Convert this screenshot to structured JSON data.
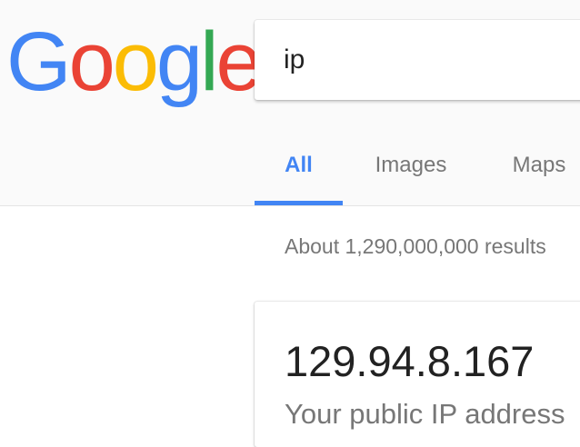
{
  "logo": {
    "letters": [
      "G",
      "o",
      "o",
      "g",
      "l",
      "e"
    ],
    "colors": [
      "#4285f4",
      "#ea4335",
      "#fbbc05",
      "#4285f4",
      "#34a853",
      "#ea4335"
    ]
  },
  "search": {
    "value": "ip"
  },
  "tabs": [
    {
      "label": "All",
      "active": true
    },
    {
      "label": "Images",
      "active": false
    },
    {
      "label": "Maps",
      "active": false
    }
  ],
  "colors": {
    "accent": "#4285f4",
    "header_bg": "#fafafa",
    "muted_text": "#777777"
  },
  "results": {
    "stats": "About 1,290,000,000 results"
  },
  "ip_card": {
    "ip": "129.94.8.167",
    "caption": "Your public IP address"
  }
}
